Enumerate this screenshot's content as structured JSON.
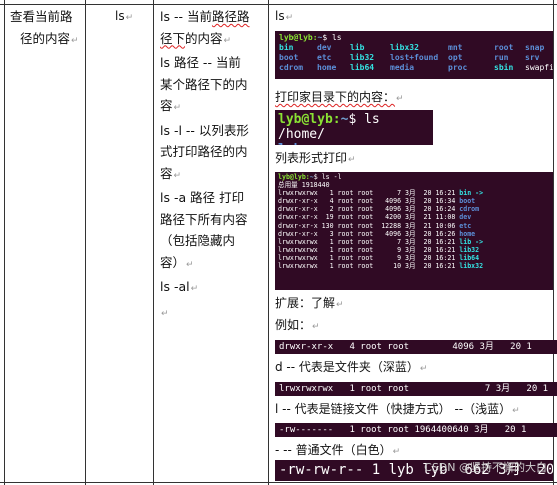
{
  "col1": {
    "topic": "查看当前路",
    "topic2": "径的内容"
  },
  "col2": {
    "command": "ls"
  },
  "col3": {
    "lines": [
      "ls -- 当前路径路",
      "径下的内容",
      "ls 路径 -- 当前",
      "某个路径下的内",
      "容",
      "ls -l -- 以列表形",
      "式打印路径的内",
      "容",
      "ls -a 路径 打印",
      "路径下所有内容",
      "（包括隐藏内",
      "容）",
      "ls -al",
      ""
    ]
  },
  "col4": {
    "cmd_label": "ls",
    "term_ls": {
      "prompt": "lyb@lyb:",
      "path": "~",
      "cmd": "$ ls",
      "items": [
        {
          "t": "bin",
          "c": "cyan"
        },
        {
          "t": "dev",
          "c": "blue"
        },
        {
          "t": "lib",
          "c": "cyan"
        },
        {
          "t": "libx32",
          "c": "cyan"
        },
        {
          "t": "mnt",
          "c": "blue"
        },
        {
          "t": "root",
          "c": "blue"
        },
        {
          "t": "snap",
          "c": "blue"
        },
        {
          "t": "boot",
          "c": "blue"
        },
        {
          "t": "etc",
          "c": "blue"
        },
        {
          "t": "lib32",
          "c": "cyan"
        },
        {
          "t": "lost+found",
          "c": "blue"
        },
        {
          "t": "opt",
          "c": "blue"
        },
        {
          "t": "run",
          "c": "blue"
        },
        {
          "t": "srv",
          "c": "blue"
        },
        {
          "t": "cdrom",
          "c": "blue"
        },
        {
          "t": "home",
          "c": "blue"
        },
        {
          "t": "lib64",
          "c": "cyan"
        },
        {
          "t": "media",
          "c": "blue"
        },
        {
          "t": "proc",
          "c": "blue"
        },
        {
          "t": "sbin",
          "c": "cyan"
        },
        {
          "t": "swapfile",
          "c": "white"
        }
      ]
    },
    "heading_home": "打印家目录下的内容：",
    "term_home": {
      "prompt": "lyb@lyb:",
      "path": "~",
      "cmd": "$ ls /home/",
      "out": "lyb"
    },
    "heading_list": "列表形式打印",
    "term_ll": {
      "prompt": "lyb@lyb:",
      "path": "~",
      "cmd": "$ ls -l",
      "total": "总用量 1918440",
      "rows": [
        {
          "l": "lrwxrwxrwx   1 root root      7 3月  20 16:21 ",
          "n": "bin -> ",
          "c": "cyan"
        },
        {
          "l": "drwxr-xr-x   4 root root   4096 3月  20 16:34 ",
          "n": "boot",
          "c": "blue"
        },
        {
          "l": "drwxr-xr-x   2 root root   4096 3月  20 16:24 ",
          "n": "cdrom",
          "c": "blue"
        },
        {
          "l": "drwxr-xr-x  19 root root   4200 3月  21 11:08 ",
          "n": "dev",
          "c": "blue"
        },
        {
          "l": "drwxr-xr-x 130 root root  12288 3月  21 10:06 ",
          "n": "etc",
          "c": "blue"
        },
        {
          "l": "drwxr-xr-x   3 root root   4096 3月  20 16:26 ",
          "n": "home",
          "c": "blue"
        },
        {
          "l": "lrwxrwxrwx   1 root root      7 3月  20 16:21 ",
          "n": "lib ->",
          "c": "cyan"
        },
        {
          "l": "lrwxrwxrwx   1 root root      9 3月  20 16:21 ",
          "n": "lib32",
          "c": "cyan"
        },
        {
          "l": "lrwxrwxrwx   1 root root      9 3月  20 16:21 ",
          "n": "lib64",
          "c": "cyan"
        },
        {
          "l": "lrwxrwxrwx   1 root root     10 3月  20 16:21 ",
          "n": "libx32",
          "c": "cyan"
        }
      ]
    },
    "heading_ext": "扩展：了解",
    "heading_example": "例如：",
    "strip_dir": "drwxr-xr-x   4 root root        4096 3月   20 1",
    "note_dir": "d -- 代表是文件夹（深蓝）",
    "strip_link": "lrwxrwxrwx   1 root root              7 3月   20 1",
    "note_link": "l -- 代表是链接文件（快捷方式） --（浅蓝）",
    "strip_file": "-rw-------   1 root root 1964400640 3月   20 1",
    "note_file": "- -- 普通文件（白色）",
    "strip_big": "-rw-rw-r-- 1 lyb lyb  662 3月  20 1",
    "watermark": "CSDN @坚持不懈的大白"
  },
  "colors": {
    "terminal_bg": "#300a24",
    "dir_blue": "#5c8fd8",
    "link_cyan": "#34e2e2",
    "prompt_green": "#8ae234"
  }
}
